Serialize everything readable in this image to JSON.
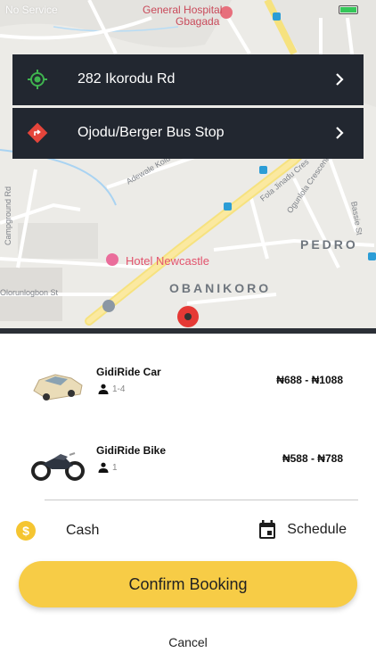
{
  "status_bar": {
    "carrier": "No Service",
    "battery_level": 0.9,
    "battery_color": "#34c759"
  },
  "map": {
    "labels": {
      "hospital": "General Hospital",
      "gbagada": "Gbagada",
      "hotel": "Hotel Newcastle",
      "district_pedro": "PEDRO",
      "district_obanikoro": "OBANIKORO",
      "street_adewale": "Adewale Kolu St",
      "street_fola": "Fola Jinadu Cres",
      "street_ogunlola": "Ogunlola Crescent",
      "street_bassie": "Bassie St",
      "street_campground": "Campground Rd",
      "street_olorun": "Olorunlogbon St"
    },
    "pin_color": "#e53935"
  },
  "route": {
    "pickup": {
      "address": "282 Ikorodu Rd",
      "icon": "location-target-icon",
      "color": "#3fb34f"
    },
    "dropoff": {
      "address": "Ojodu/Berger Bus Stop",
      "icon": "direction-diamond-icon",
      "color": "#e5453b"
    }
  },
  "rides": [
    {
      "name": "GidiRide Car",
      "seats": "1-4",
      "price": "₦688 - ₦1088",
      "icon": "car-image"
    },
    {
      "name": "GidiRide Bike",
      "seats": "1",
      "price": "₦588 - ₦788",
      "icon": "motorbike-image"
    }
  ],
  "payment": {
    "label": "Cash",
    "icon": "dollar-coin-icon",
    "icon_glyph": "$",
    "color": "#f5c531"
  },
  "schedule": {
    "label": "Schedule",
    "icon": "calendar-icon"
  },
  "actions": {
    "confirm_label": "Confirm Booking",
    "confirm_color": "#f7cc46",
    "cancel_label": "Cancel"
  }
}
